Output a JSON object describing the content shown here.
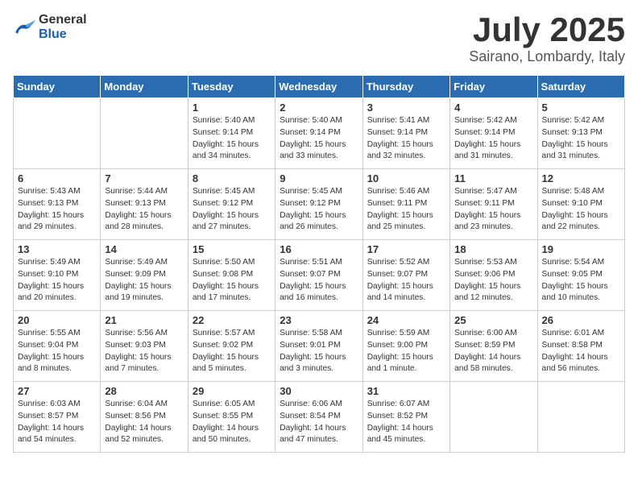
{
  "header": {
    "logo": {
      "general": "General",
      "blue": "Blue"
    },
    "title": "July 2025",
    "location": "Sairano, Lombardy, Italy"
  },
  "days_of_week": [
    "Sunday",
    "Monday",
    "Tuesday",
    "Wednesday",
    "Thursday",
    "Friday",
    "Saturday"
  ],
  "weeks": [
    [
      {
        "day": null,
        "info": null
      },
      {
        "day": null,
        "info": null
      },
      {
        "day": "1",
        "info": "Sunrise: 5:40 AM\nSunset: 9:14 PM\nDaylight: 15 hours\nand 34 minutes."
      },
      {
        "day": "2",
        "info": "Sunrise: 5:40 AM\nSunset: 9:14 PM\nDaylight: 15 hours\nand 33 minutes."
      },
      {
        "day": "3",
        "info": "Sunrise: 5:41 AM\nSunset: 9:14 PM\nDaylight: 15 hours\nand 32 minutes."
      },
      {
        "day": "4",
        "info": "Sunrise: 5:42 AM\nSunset: 9:14 PM\nDaylight: 15 hours\nand 31 minutes."
      },
      {
        "day": "5",
        "info": "Sunrise: 5:42 AM\nSunset: 9:13 PM\nDaylight: 15 hours\nand 31 minutes."
      }
    ],
    [
      {
        "day": "6",
        "info": "Sunrise: 5:43 AM\nSunset: 9:13 PM\nDaylight: 15 hours\nand 29 minutes."
      },
      {
        "day": "7",
        "info": "Sunrise: 5:44 AM\nSunset: 9:13 PM\nDaylight: 15 hours\nand 28 minutes."
      },
      {
        "day": "8",
        "info": "Sunrise: 5:45 AM\nSunset: 9:12 PM\nDaylight: 15 hours\nand 27 minutes."
      },
      {
        "day": "9",
        "info": "Sunrise: 5:45 AM\nSunset: 9:12 PM\nDaylight: 15 hours\nand 26 minutes."
      },
      {
        "day": "10",
        "info": "Sunrise: 5:46 AM\nSunset: 9:11 PM\nDaylight: 15 hours\nand 25 minutes."
      },
      {
        "day": "11",
        "info": "Sunrise: 5:47 AM\nSunset: 9:11 PM\nDaylight: 15 hours\nand 23 minutes."
      },
      {
        "day": "12",
        "info": "Sunrise: 5:48 AM\nSunset: 9:10 PM\nDaylight: 15 hours\nand 22 minutes."
      }
    ],
    [
      {
        "day": "13",
        "info": "Sunrise: 5:49 AM\nSunset: 9:10 PM\nDaylight: 15 hours\nand 20 minutes."
      },
      {
        "day": "14",
        "info": "Sunrise: 5:49 AM\nSunset: 9:09 PM\nDaylight: 15 hours\nand 19 minutes."
      },
      {
        "day": "15",
        "info": "Sunrise: 5:50 AM\nSunset: 9:08 PM\nDaylight: 15 hours\nand 17 minutes."
      },
      {
        "day": "16",
        "info": "Sunrise: 5:51 AM\nSunset: 9:07 PM\nDaylight: 15 hours\nand 16 minutes."
      },
      {
        "day": "17",
        "info": "Sunrise: 5:52 AM\nSunset: 9:07 PM\nDaylight: 15 hours\nand 14 minutes."
      },
      {
        "day": "18",
        "info": "Sunrise: 5:53 AM\nSunset: 9:06 PM\nDaylight: 15 hours\nand 12 minutes."
      },
      {
        "day": "19",
        "info": "Sunrise: 5:54 AM\nSunset: 9:05 PM\nDaylight: 15 hours\nand 10 minutes."
      }
    ],
    [
      {
        "day": "20",
        "info": "Sunrise: 5:55 AM\nSunset: 9:04 PM\nDaylight: 15 hours\nand 8 minutes."
      },
      {
        "day": "21",
        "info": "Sunrise: 5:56 AM\nSunset: 9:03 PM\nDaylight: 15 hours\nand 7 minutes."
      },
      {
        "day": "22",
        "info": "Sunrise: 5:57 AM\nSunset: 9:02 PM\nDaylight: 15 hours\nand 5 minutes."
      },
      {
        "day": "23",
        "info": "Sunrise: 5:58 AM\nSunset: 9:01 PM\nDaylight: 15 hours\nand 3 minutes."
      },
      {
        "day": "24",
        "info": "Sunrise: 5:59 AM\nSunset: 9:00 PM\nDaylight: 15 hours\nand 1 minute."
      },
      {
        "day": "25",
        "info": "Sunrise: 6:00 AM\nSunset: 8:59 PM\nDaylight: 14 hours\nand 58 minutes."
      },
      {
        "day": "26",
        "info": "Sunrise: 6:01 AM\nSunset: 8:58 PM\nDaylight: 14 hours\nand 56 minutes."
      }
    ],
    [
      {
        "day": "27",
        "info": "Sunrise: 6:03 AM\nSunset: 8:57 PM\nDaylight: 14 hours\nand 54 minutes."
      },
      {
        "day": "28",
        "info": "Sunrise: 6:04 AM\nSunset: 8:56 PM\nDaylight: 14 hours\nand 52 minutes."
      },
      {
        "day": "29",
        "info": "Sunrise: 6:05 AM\nSunset: 8:55 PM\nDaylight: 14 hours\nand 50 minutes."
      },
      {
        "day": "30",
        "info": "Sunrise: 6:06 AM\nSunset: 8:54 PM\nDaylight: 14 hours\nand 47 minutes."
      },
      {
        "day": "31",
        "info": "Sunrise: 6:07 AM\nSunset: 8:52 PM\nDaylight: 14 hours\nand 45 minutes."
      },
      {
        "day": null,
        "info": null
      },
      {
        "day": null,
        "info": null
      }
    ]
  ]
}
